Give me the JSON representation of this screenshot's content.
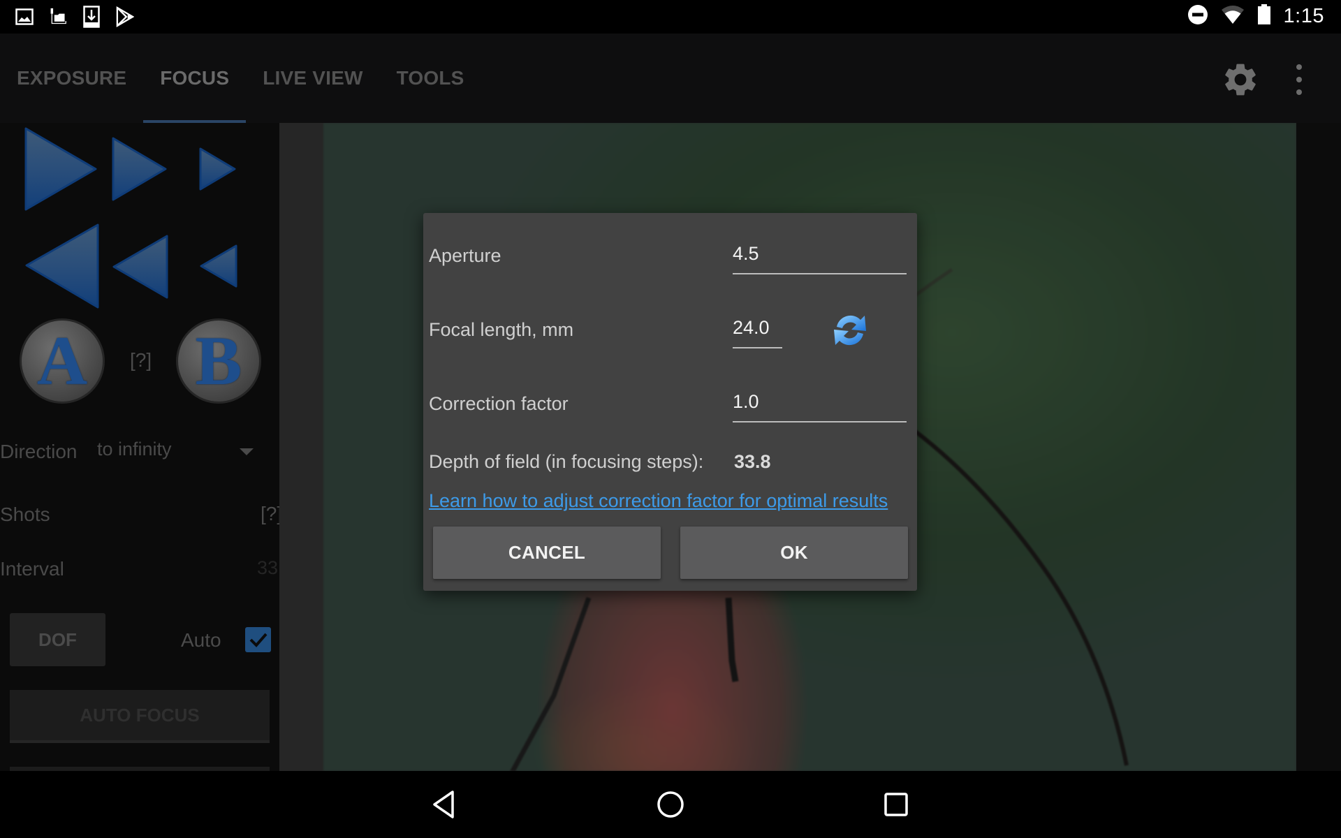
{
  "status_bar": {
    "left_icons": [
      "image-notification-icon",
      "usb-camera-notification-icon",
      "download-notification-icon",
      "play-store-notification-icon"
    ],
    "right_icons": [
      "do-not-disturb-icon",
      "wifi-icon",
      "battery-icon"
    ],
    "time": "1:15"
  },
  "app_bar": {
    "tabs": [
      {
        "label": "EXPOSURE",
        "active": false
      },
      {
        "label": "FOCUS",
        "active": true
      },
      {
        "label": "LIVE VIEW",
        "active": false
      },
      {
        "label": "TOOLS",
        "active": false
      }
    ],
    "settings_icon": "gear-icon",
    "overflow_icon": "more-vert-icon"
  },
  "left_panel": {
    "focus_forward_buttons": [
      "focus-forward-large",
      "focus-forward-medium",
      "focus-forward-small"
    ],
    "focus_backward_buttons": [
      "focus-backward-large",
      "focus-backward-medium",
      "focus-backward-small"
    ],
    "point_a_label": "A",
    "point_b_label": "B",
    "ab_help": "[?]",
    "direction_label": "Direction",
    "direction_value": "to infinity",
    "shots_label": "Shots",
    "shots_help": "[?]",
    "interval_label": "Interval",
    "interval_value": "33",
    "dof_button": "DOF",
    "auto_label": "Auto",
    "auto_checked": true,
    "auto_focus_button": "AUTO FOCUS"
  },
  "dialog": {
    "aperture_label": "Aperture",
    "aperture_value": "4.5",
    "focal_length_label": "Focal length, mm",
    "focal_length_value": "24.0",
    "correction_label": "Correction factor",
    "correction_value": "1.0",
    "dof_label": "Depth of field (in focusing steps):",
    "dof_value": "33.8",
    "link_text": "Learn how to adjust correction factor for optimal results",
    "cancel_label": "CANCEL",
    "ok_label": "OK",
    "colors": {
      "background": "#424242",
      "link": "#3d9be9",
      "button": "#5b5b5c"
    }
  },
  "nav_bar": {
    "buttons": [
      "back",
      "home",
      "recents"
    ]
  }
}
